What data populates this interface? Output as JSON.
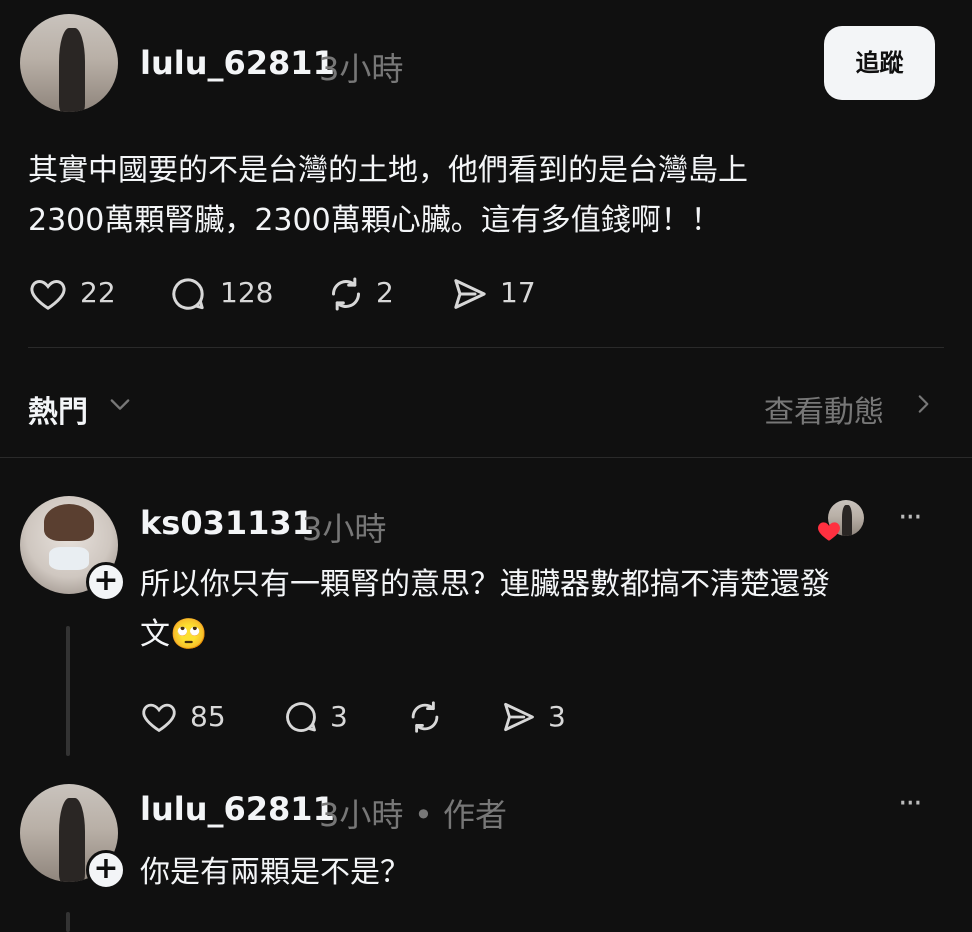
{
  "post": {
    "username": "lulu_62811",
    "time": "3小時",
    "follow_label": "追蹤",
    "text_line1": "其實中國要的不是台灣的土地，他們看到的是台灣島上",
    "text_line2": "2300萬顆腎臟，2300萬顆心臟。這有多值錢啊！！",
    "likes": "22",
    "comments": "128",
    "reposts": "2",
    "shares": "17"
  },
  "sort": {
    "label": "熱門",
    "view_activity": "查看動態"
  },
  "comments": [
    {
      "username": "ks031131",
      "time": "3小時",
      "text_line1": "所以你只有一顆腎的意思？連臟器數都搞不清楚還發",
      "text_line2": "文🙄",
      "likes": "85",
      "comments": "3",
      "shares": "3",
      "more": "···"
    },
    {
      "username": "lulu_62811",
      "time": "3小時",
      "author_tag": "• 作者",
      "text": "你是有兩顆是不是？",
      "more": "···"
    }
  ],
  "icons": [
    "heart-icon",
    "comment-icon",
    "repost-icon",
    "share-icon",
    "chevron-down-icon",
    "chevron-right-icon",
    "more-icon",
    "plus-icon"
  ],
  "colors": {
    "background": "#101010",
    "text": "#f3f5f7",
    "muted": "#777777",
    "like_red": "#ff3040"
  }
}
